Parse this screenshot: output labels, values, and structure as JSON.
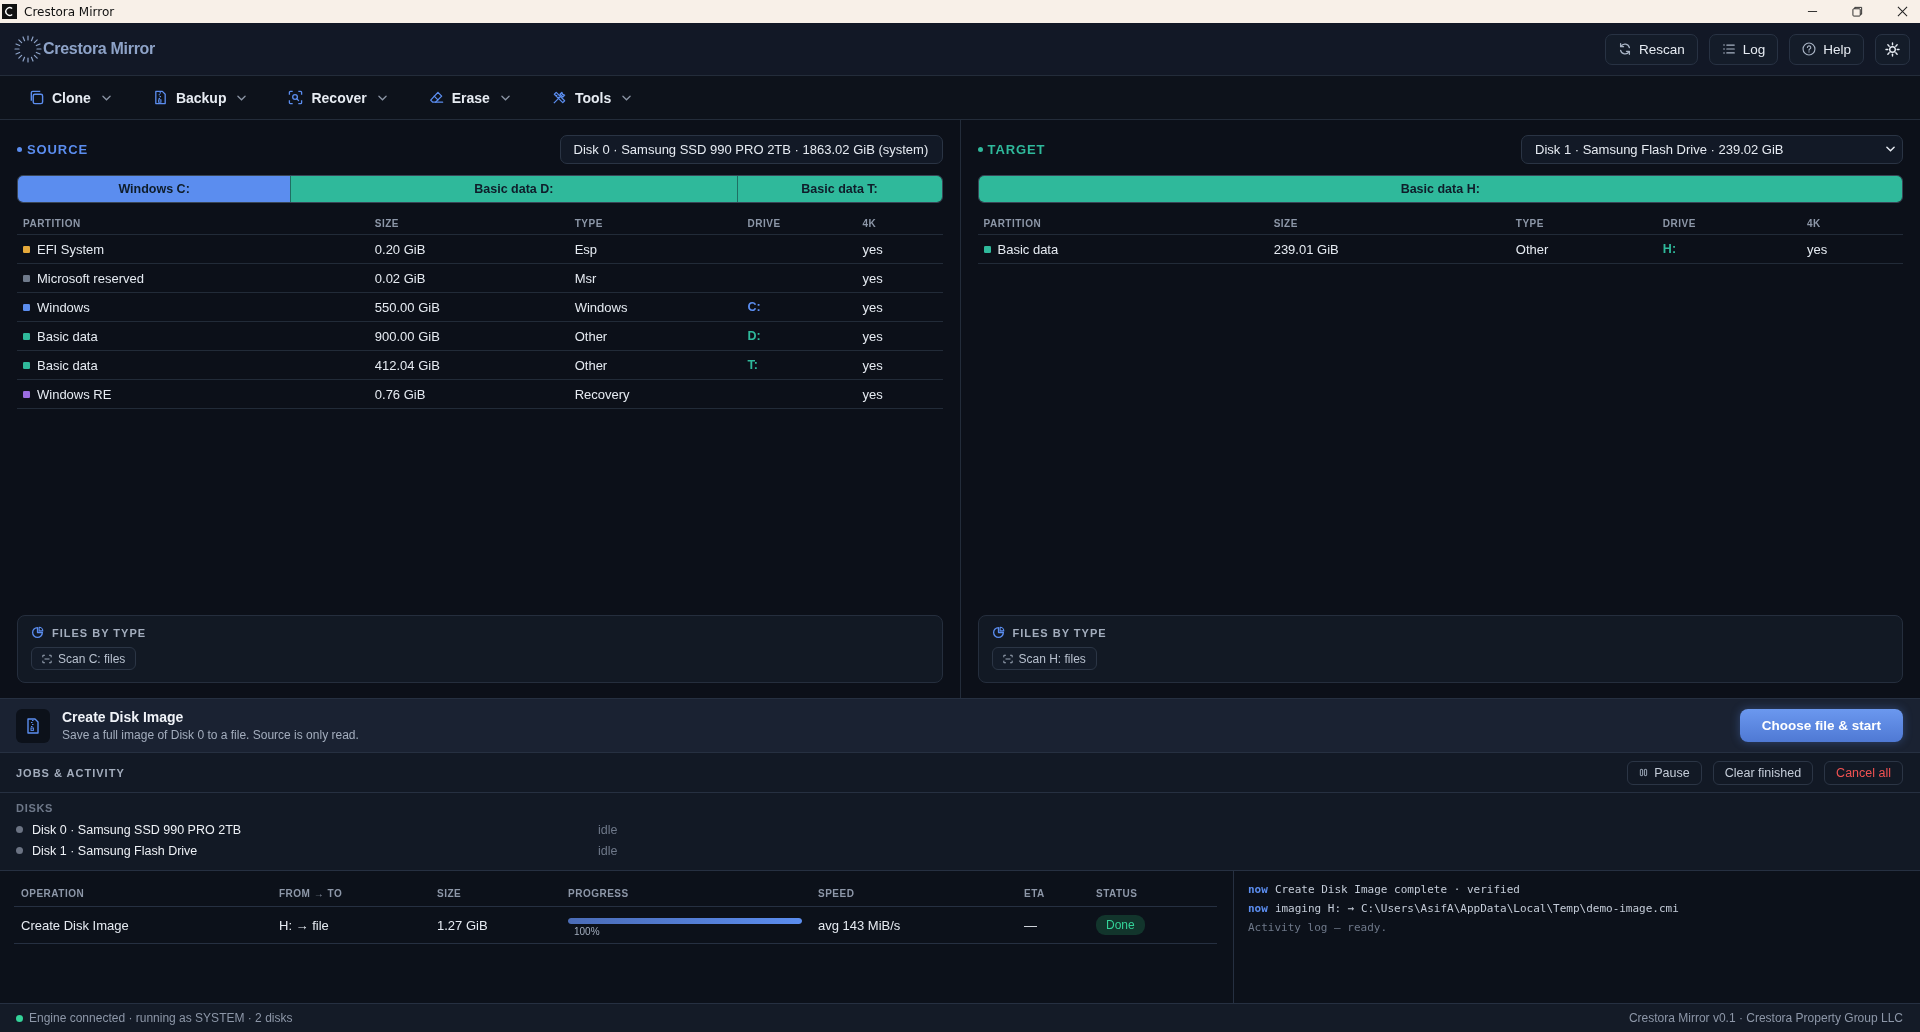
{
  "window": {
    "title": "Crestora Mirror"
  },
  "header": {
    "logo": "Crestora Mirror",
    "buttons": [
      "Rescan",
      "Log",
      "Help"
    ]
  },
  "menu": [
    "Clone",
    "Backup",
    "Recover",
    "Erase",
    "Tools"
  ],
  "panels": [
    {
      "title": "SOURCE",
      "color": "#5b8def",
      "disk": "Disk 0 · Samsung SSD 990 PRO 2TB · 1863.02 GiB (system)",
      "segments": [
        {
          "label": "Windows C:",
          "color": "#5b8def"
        },
        {
          "label": "Basic data D:",
          "color": "#2fb99b"
        },
        {
          "label": "Basic data T:",
          "color": "#2fb99b"
        }
      ],
      "columns": [
        "PARTITION",
        "SIZE",
        "TYPE",
        "DRIVE",
        "4K"
      ],
      "rows": [
        {
          "partition": "EFI System",
          "size": "0.20 GiB",
          "type": "Esp",
          "4k": "yes",
          "color": "#e5a93b"
        },
        {
          "partition": "Microsoft reserved",
          "size": "0.02 GiB",
          "type": "Msr",
          "4k": "yes",
          "color": "#6f7a8b"
        },
        {
          "partition": "Windows",
          "size": "550.00 GiB",
          "type": "Windows",
          "drive": "C:",
          "4k": "yes",
          "color": "#5b8def"
        },
        {
          "partition": "Basic data",
          "size": "900.00 GiB",
          "type": "Other",
          "drive": "D:",
          "4k": "yes",
          "color": "#2fb99b"
        },
        {
          "partition": "Basic data",
          "size": "412.04 GiB",
          "type": "Other",
          "drive": "T:",
          "4k": "yes",
          "color": "#2fb99b"
        },
        {
          "partition": "Windows RE",
          "size": "0.76 GiB",
          "type": "Recovery",
          "4k": "yes",
          "color": "#9a6ce0"
        }
      ],
      "files_card": {
        "title": "FILES BY TYPE",
        "button": "Scan C: files"
      }
    },
    {
      "title": "TARGET",
      "color": "#2fb99b",
      "disk": "Disk 1 · Samsung Flash Drive · 239.02 GiB",
      "segments": [
        {
          "label": "Basic data H:",
          "color": "#2fb99b"
        }
      ],
      "columns": [
        "PARTITION",
        "SIZE",
        "TYPE",
        "DRIVE",
        "4K"
      ],
      "rows": [
        {
          "partition": "Basic data",
          "size": "239.01 GiB",
          "type": "Other",
          "drive": "H:",
          "4k": "yes",
          "color": "#2fb99b"
        }
      ],
      "files_card": {
        "title": "FILES BY TYPE",
        "button": "Scan H: files"
      }
    }
  ],
  "action": {
    "title": "Create Disk Image",
    "description": "Save a full image of Disk 0 to a file. Source is only read.",
    "button": "Choose file & start"
  },
  "jobs": {
    "title": "JOBS & ACTIVITY",
    "buttons": [
      {
        "label": "Pause",
        "kind": "pause"
      },
      {
        "label": "Clear finished",
        "kind": "plain"
      },
      {
        "label": "Cancel all",
        "kind": "danger"
      }
    ]
  },
  "disks": {
    "title": "DISKS",
    "items": [
      {
        "name": "Disk 0 · Samsung SSD 990 PRO 2TB",
        "status": "idle",
        "color": "#6b7383"
      },
      {
        "name": "Disk 1 · Samsung Flash Drive",
        "status": "idle",
        "color": "#6b7383"
      }
    ]
  },
  "operations": {
    "columns": [
      "OPERATION",
      "FROM → TO",
      "SIZE",
      "PROGRESS",
      "SPEED",
      "ETA",
      "STATUS"
    ],
    "rows": [
      {
        "operation": "Create Disk Image",
        "from_to": "H: → file",
        "size": "1.27 GiB",
        "level": 1,
        "progress": "100%",
        "speed": "avg 143 MiB/s",
        "eta": "—",
        "status": "Done"
      }
    ]
  },
  "log": [
    {
      "kind": "event",
      "time": "now",
      "text": "Create Disk Image complete · verified"
    },
    {
      "kind": "event",
      "time": "now",
      "text": "imaging H: → C:\\Users\\AsifA\\AppData\\Local\\Temp\\demo-image.cmi"
    },
    {
      "kind": "info",
      "text": "Activity log — ready."
    }
  ],
  "status_bar": {
    "connected": true,
    "text": "Engine connected · running as SYSTEM · 2 disks",
    "right": "Crestora Mirror v0.1 · Crestora Property Group LLC"
  }
}
